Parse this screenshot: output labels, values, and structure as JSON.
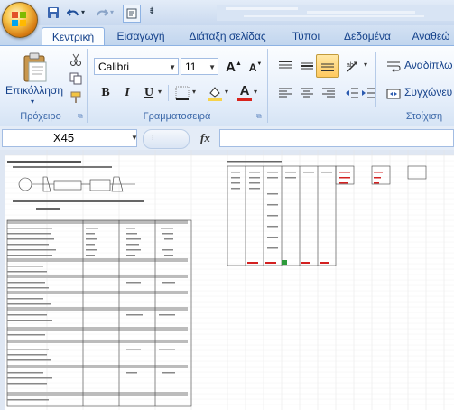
{
  "quick_access": {
    "save_icon": "save-icon",
    "undo_icon": "undo-icon",
    "redo_icon": "redo-icon",
    "print_preview_icon": "print-preview-icon",
    "customize_icon": "customize-qat-icon"
  },
  "tabs": [
    {
      "label": "Κεντρική",
      "active": true
    },
    {
      "label": "Εισαγωγή",
      "active": false
    },
    {
      "label": "Διάταξη σελίδας",
      "active": false
    },
    {
      "label": "Τύποι",
      "active": false
    },
    {
      "label": "Δεδομένα",
      "active": false
    },
    {
      "label": "Αναθεώ",
      "active": false
    }
  ],
  "ribbon": {
    "clipboard": {
      "paste_label": "Επικόλληση",
      "group_label": "Πρόχειρο"
    },
    "font": {
      "font_name": "Calibri",
      "font_size": "11",
      "bold": "B",
      "italic": "I",
      "underline": "U",
      "grow": "A",
      "shrink": "A",
      "font_color": "A",
      "group_label": "Γραμματοσειρά",
      "accent_fill": "#f7d24a",
      "accent_font": "#d8231c"
    },
    "alignment": {
      "wrap_label": "Αναδίπλω",
      "merge_label": "Συγχώνευ",
      "group_label": "Στοίχιση"
    }
  },
  "formula_bar": {
    "name_box": "X45",
    "fx": "fx",
    "formula": ""
  }
}
